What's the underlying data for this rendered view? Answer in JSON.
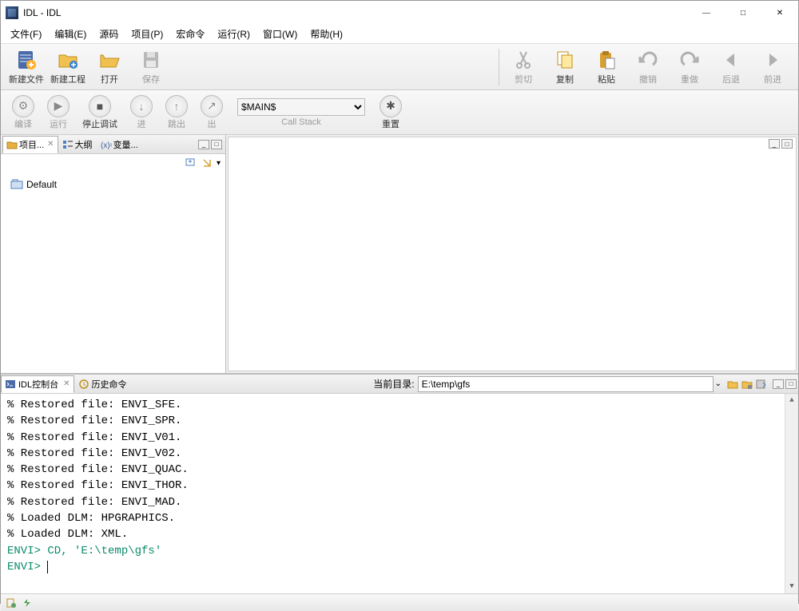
{
  "window": {
    "title": "IDL - IDL"
  },
  "menu": {
    "file": "文件(F)",
    "edit": "编辑(E)",
    "source": "源码",
    "project": "项目(P)",
    "macros": "宏命令",
    "run": "运行(R)",
    "window": "窗口(W)",
    "help": "帮助(H)"
  },
  "toolbar1": {
    "new_file": "新建文件",
    "new_project": "新建工程",
    "open": "打开",
    "save": "保存",
    "cut": "剪切",
    "copy": "复制",
    "paste": "粘贴",
    "undo": "撤销",
    "redo": "重做",
    "back": "后退",
    "forward": "前进"
  },
  "toolbar2": {
    "compile": "编译",
    "run": "运行",
    "stop": "停止调试",
    "step_in": "进",
    "step_out": "跳出",
    "step_over": "出",
    "call_stack_label": "Call Stack",
    "call_stack_value": "$MAIN$",
    "reset": "重置"
  },
  "left_panel": {
    "tabs": {
      "project": "项目...",
      "outline": "大纲",
      "variables": "变量..."
    },
    "tree_root": "Default"
  },
  "bottom_panel": {
    "tabs": {
      "console": "IDL控制台",
      "history": "历史命令"
    },
    "dir_label": "当前目录:",
    "dir_value": "E:\\temp\\gfs"
  },
  "console_lines": [
    "% Restored file: ENVI_SFE.",
    "% Restored file: ENVI_SPR.",
    "% Restored file: ENVI_V01.",
    "% Restored file: ENVI_V02.",
    "% Restored file: ENVI_QUAC.",
    "% Restored file: ENVI_THOR.",
    "% Restored file: ENVI_MAD.",
    "% Loaded DLM: HPGRAPHICS.",
    "% Loaded DLM: XML."
  ],
  "console_prompt_cmd": "ENVI> CD, 'E:\\temp\\gfs'",
  "console_prompt": "ENVI> "
}
